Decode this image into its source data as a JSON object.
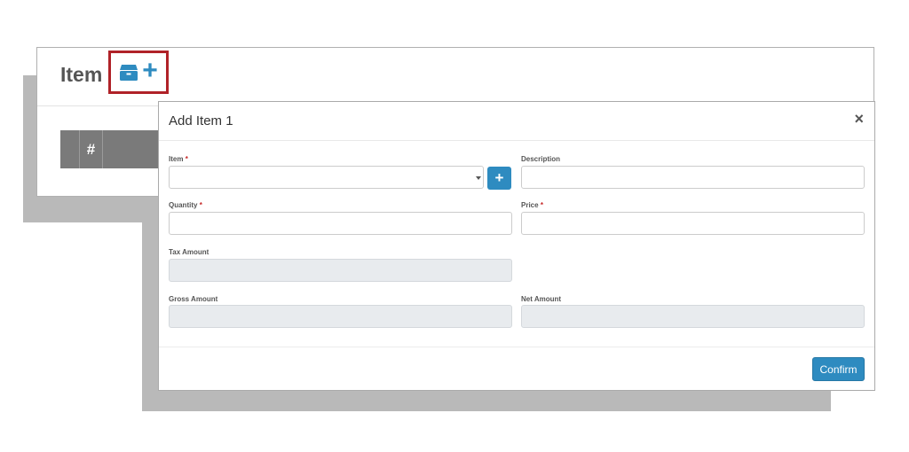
{
  "page": {
    "title": "Item",
    "icons": {
      "add": "box-plus-icon"
    },
    "table": {
      "headers": [
        "#"
      ]
    }
  },
  "modal": {
    "title": "Add Item 1",
    "close_label": "×",
    "fields": {
      "item": {
        "label": "Item",
        "required_mark": "*",
        "value": ""
      },
      "description": {
        "label": "Description",
        "value": ""
      },
      "quantity": {
        "label": "Quantity",
        "required_mark": "*",
        "value": ""
      },
      "price": {
        "label": "Price",
        "required_mark": "*",
        "value": ""
      },
      "tax_amount": {
        "label": "Tax Amount",
        "value": ""
      },
      "gross_amount": {
        "label": "Gross Amount",
        "value": ""
      },
      "net_amount": {
        "label": "Net Amount",
        "value": ""
      }
    },
    "add_item_label": "+",
    "confirm_label": "Confirm"
  },
  "colors": {
    "accent": "#2e8bc0",
    "highlight": "#b02228",
    "required": "#c62828"
  }
}
